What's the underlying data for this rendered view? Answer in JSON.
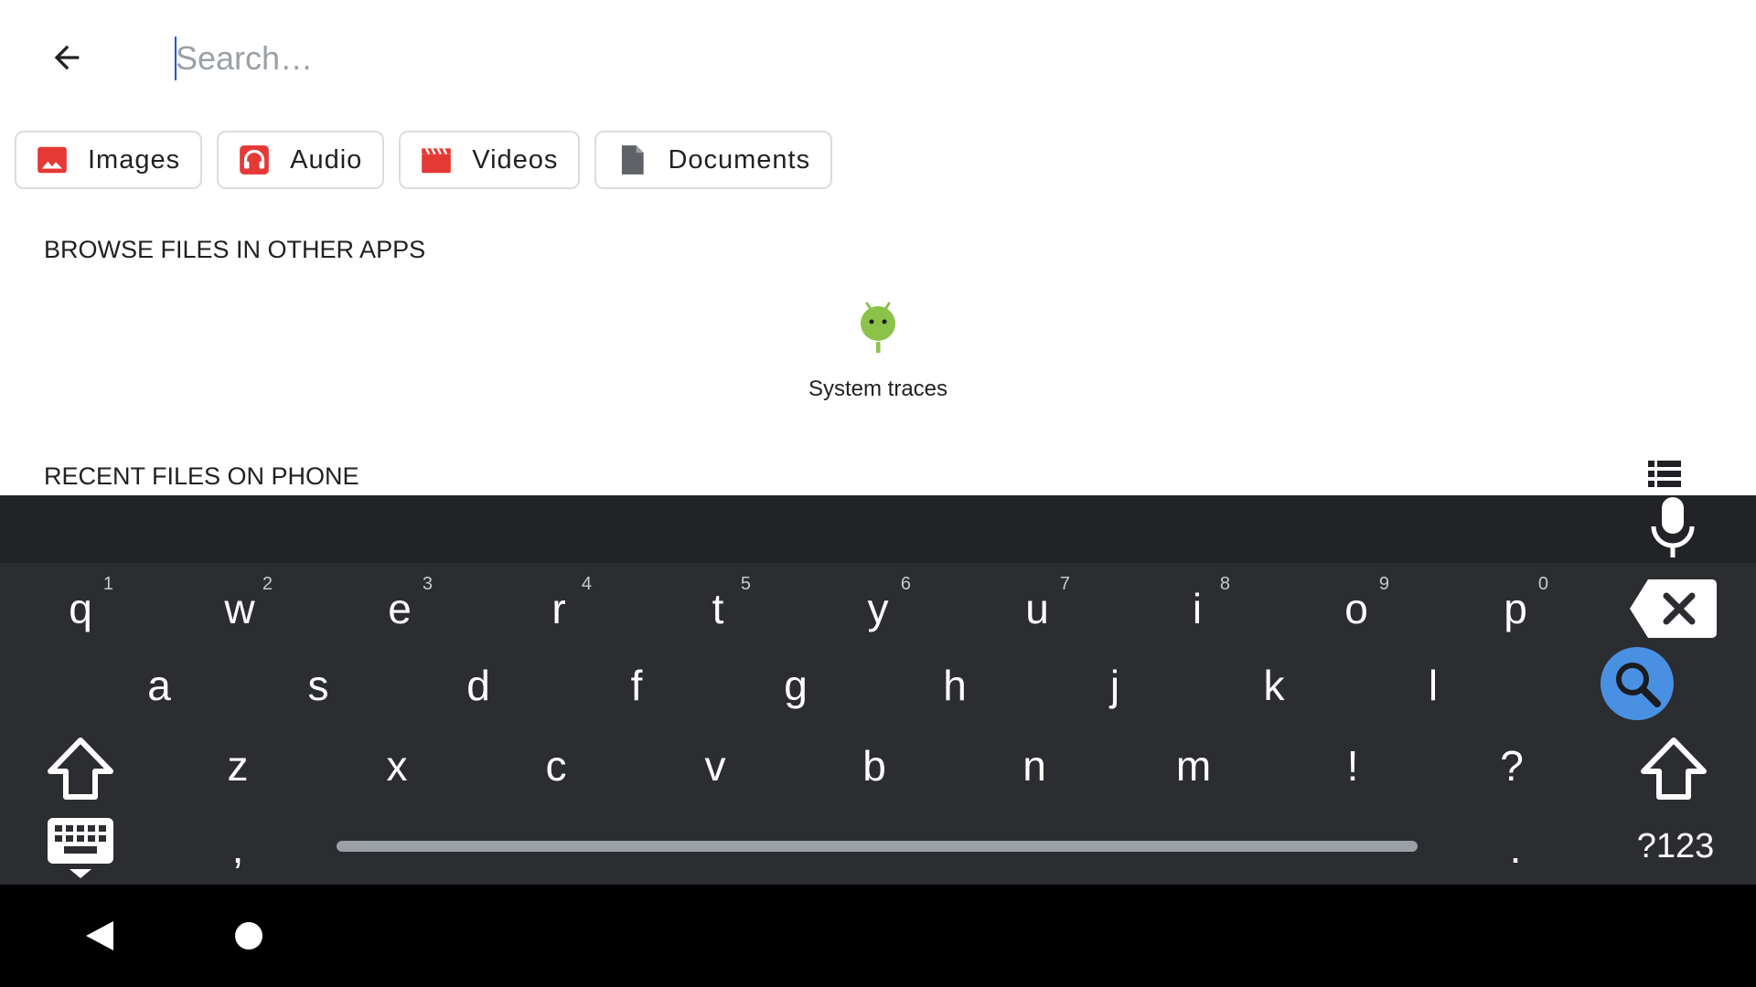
{
  "search": {
    "placeholder": "Search…",
    "value": ""
  },
  "chips": [
    {
      "label": "Images",
      "icon": "image-icon",
      "color": "#e53935"
    },
    {
      "label": "Audio",
      "icon": "headphones-icon",
      "color": "#e53935"
    },
    {
      "label": "Videos",
      "icon": "clapperboard-icon",
      "color": "#e53935"
    },
    {
      "label": "Documents",
      "icon": "document-icon",
      "color": "#5f6368"
    }
  ],
  "sections": {
    "browse_title": "BROWSE FILES IN OTHER APPS",
    "recent_title": "RECENT FILES ON PHONE"
  },
  "apps": [
    {
      "label": "System traces",
      "icon": "android-icon",
      "color": "#8bc34a"
    }
  ],
  "keyboard": {
    "row1": [
      {
        "k": "q",
        "h": "1"
      },
      {
        "k": "w",
        "h": "2"
      },
      {
        "k": "e",
        "h": "3"
      },
      {
        "k": "r",
        "h": "4"
      },
      {
        "k": "t",
        "h": "5"
      },
      {
        "k": "y",
        "h": "6"
      },
      {
        "k": "u",
        "h": "7"
      },
      {
        "k": "i",
        "h": "8"
      },
      {
        "k": "o",
        "h": "9"
      },
      {
        "k": "p",
        "h": "0"
      }
    ],
    "row2": [
      "a",
      "s",
      "d",
      "f",
      "g",
      "h",
      "j",
      "k",
      "l"
    ],
    "row3": [
      "z",
      "x",
      "c",
      "v",
      "b",
      "n",
      "m",
      "!",
      "?"
    ],
    "row4": {
      "comma": ",",
      "period": ".",
      "symbols": "?123"
    },
    "accent_color": "#4a90e2",
    "background": "#2b2d31"
  }
}
